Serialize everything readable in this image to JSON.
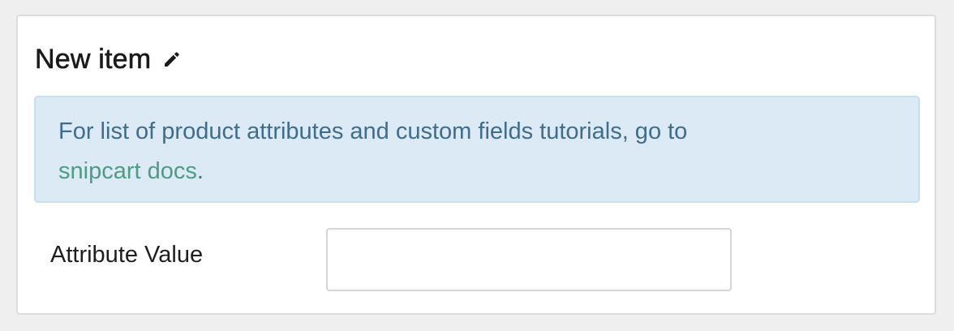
{
  "header": {
    "title": "New item",
    "edit_icon": "pencil-icon"
  },
  "info": {
    "text_before": "For list of product attributes and custom fields tutorials, go to",
    "link_text": "snipcart docs",
    "text_after": "."
  },
  "form": {
    "attribute_value_label": "Attribute Value",
    "attribute_value": "",
    "attribute_value_placeholder": ""
  },
  "colors": {
    "info_background": "#dceaf5",
    "info_text": "#3f6d8c",
    "link": "#4e9c84"
  }
}
